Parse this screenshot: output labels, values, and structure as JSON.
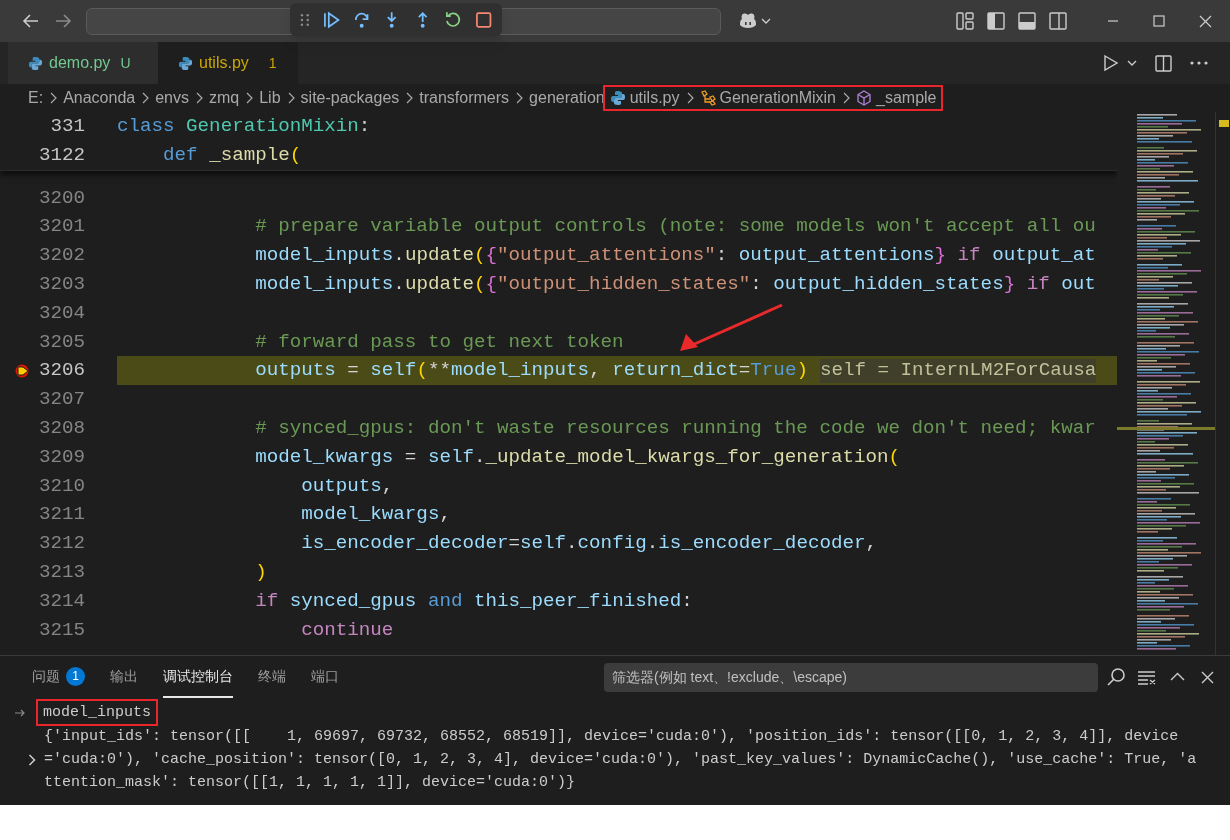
{
  "tabs": [
    {
      "label": "demo.py",
      "badge": "U",
      "kind": "untracked",
      "selected": false
    },
    {
      "label": "utils.py",
      "badge": "1",
      "kind": "problems",
      "selected": true
    }
  ],
  "breadcrumb": [
    {
      "label": "E:",
      "kind": "folder",
      "annotated": false
    },
    {
      "label": "Anaconda",
      "kind": "folder",
      "annotated": false
    },
    {
      "label": "envs",
      "kind": "folder",
      "annotated": false
    },
    {
      "label": "zmq",
      "kind": "folder",
      "annotated": false
    },
    {
      "label": "Lib",
      "kind": "folder",
      "annotated": false
    },
    {
      "label": "site-packages",
      "kind": "folder",
      "annotated": false
    },
    {
      "label": "transformers",
      "kind": "folder",
      "annotated": false
    },
    {
      "label": "generation",
      "kind": "folder",
      "annotated": false
    },
    {
      "label": "utils.py",
      "kind": "python_file",
      "annotated": true
    },
    {
      "label": "GenerationMixin",
      "kind": "class",
      "annotated": true
    },
    {
      "label": "_sample",
      "kind": "method",
      "annotated": true
    }
  ],
  "sticky_lines": [
    {
      "number": "331",
      "tokens": [
        {
          "text": "class ",
          "kind": "kw"
        },
        {
          "text": "GenerationMixin",
          "kind": "cls"
        },
        {
          "text": ":",
          "kind": "op"
        }
      ]
    },
    {
      "number": "3122",
      "tokens": [
        {
          "text": "    def ",
          "kind": "kw"
        },
        {
          "text": "_sample",
          "kind": "fn"
        },
        {
          "text": "(",
          "kind": "br1"
        }
      ]
    }
  ],
  "code_lines": [
    {
      "number": "3200",
      "current": false
    },
    {
      "number": "3201",
      "current": false,
      "tokens": [
        {
          "text": "            # prepare variable output controls (note: some models won't accept all ou",
          "kind": "com"
        }
      ]
    },
    {
      "number": "3202",
      "current": false,
      "tokens": [
        {
          "text": "            model_inputs",
          "kind": "var"
        },
        {
          "text": ".",
          "kind": "op"
        },
        {
          "text": "update",
          "kind": "fn"
        },
        {
          "text": "(",
          "kind": "br1"
        },
        {
          "text": "{",
          "kind": "br2"
        },
        {
          "text": "\"output_attentions\"",
          "kind": "str"
        },
        {
          "text": ": ",
          "kind": "op"
        },
        {
          "text": "output_attentions",
          "kind": "var"
        },
        {
          "text": "}",
          "kind": "br2"
        },
        {
          "text": " if ",
          "kind": "ctl"
        },
        {
          "text": "output_at",
          "kind": "var"
        }
      ]
    },
    {
      "number": "3203",
      "current": false,
      "tokens": [
        {
          "text": "            model_inputs",
          "kind": "var"
        },
        {
          "text": ".",
          "kind": "op"
        },
        {
          "text": "update",
          "kind": "fn"
        },
        {
          "text": "(",
          "kind": "br1"
        },
        {
          "text": "{",
          "kind": "br2"
        },
        {
          "text": "\"output_hidden_states\"",
          "kind": "str"
        },
        {
          "text": ": ",
          "kind": "op"
        },
        {
          "text": "output_hidden_states",
          "kind": "var"
        },
        {
          "text": "}",
          "kind": "br2"
        },
        {
          "text": " if ",
          "kind": "ctl"
        },
        {
          "text": "out",
          "kind": "var"
        }
      ]
    },
    {
      "number": "3204",
      "current": false
    },
    {
      "number": "3205",
      "current": false,
      "tokens": [
        {
          "text": "            # forward pass to get next token",
          "kind": "com"
        }
      ]
    },
    {
      "number": "3206",
      "current": true,
      "inline_value": "self = InternLM2ForCausa",
      "tokens": [
        {
          "text": "            outputs",
          "kind": "var"
        },
        {
          "text": " = ",
          "kind": "op"
        },
        {
          "text": "self",
          "kind": "var"
        },
        {
          "text": "(",
          "kind": "br1"
        },
        {
          "text": "**",
          "kind": "op"
        },
        {
          "text": "model_inputs",
          "kind": "var"
        },
        {
          "text": ", ",
          "kind": "op"
        },
        {
          "text": "return_dict",
          "kind": "var"
        },
        {
          "text": "=",
          "kind": "op"
        },
        {
          "text": "True",
          "kind": "kw"
        },
        {
          "text": ")",
          "kind": "br1"
        }
      ]
    },
    {
      "number": "3207",
      "current": false
    },
    {
      "number": "3208",
      "current": false,
      "tokens": [
        {
          "text": "            # synced_gpus: don't waste resources running the code we don't need; kwar",
          "kind": "com"
        }
      ]
    },
    {
      "number": "3209",
      "current": false,
      "tokens": [
        {
          "text": "            model_kwargs",
          "kind": "var"
        },
        {
          "text": " = ",
          "kind": "op"
        },
        {
          "text": "self",
          "kind": "var"
        },
        {
          "text": ".",
          "kind": "op"
        },
        {
          "text": "_update_model_kwargs_for_generation",
          "kind": "fn"
        },
        {
          "text": "(",
          "kind": "br1"
        }
      ]
    },
    {
      "number": "3210",
      "current": false,
      "tokens": [
        {
          "text": "                outputs",
          "kind": "var"
        },
        {
          "text": ",",
          "kind": "op"
        }
      ]
    },
    {
      "number": "3211",
      "current": false,
      "tokens": [
        {
          "text": "                model_kwargs",
          "kind": "var"
        },
        {
          "text": ",",
          "kind": "op"
        }
      ]
    },
    {
      "number": "3212",
      "current": false,
      "tokens": [
        {
          "text": "                is_encoder_decoder",
          "kind": "var"
        },
        {
          "text": "=",
          "kind": "op"
        },
        {
          "text": "self",
          "kind": "var"
        },
        {
          "text": ".",
          "kind": "op"
        },
        {
          "text": "config",
          "kind": "var"
        },
        {
          "text": ".",
          "kind": "op"
        },
        {
          "text": "is_encoder_decoder",
          "kind": "var"
        },
        {
          "text": ",",
          "kind": "op"
        }
      ]
    },
    {
      "number": "3213",
      "current": false,
      "tokens": [
        {
          "text": "            )",
          "kind": "br1"
        }
      ]
    },
    {
      "number": "3214",
      "current": false,
      "tokens": [
        {
          "text": "            if ",
          "kind": "ctl"
        },
        {
          "text": "synced_gpus",
          "kind": "var"
        },
        {
          "text": " and ",
          "kind": "kw"
        },
        {
          "text": "this_peer_finished",
          "kind": "var"
        },
        {
          "text": ":",
          "kind": "op"
        }
      ]
    },
    {
      "number": "3215",
      "current": false,
      "tokens": [
        {
          "text": "                continue",
          "kind": "ctl"
        }
      ]
    }
  ],
  "panel": {
    "tabs": [
      {
        "label": "问题",
        "badge": "1",
        "selected": false
      },
      {
        "label": "输出",
        "selected": false
      },
      {
        "label": "调试控制台",
        "selected": true
      },
      {
        "label": "终端",
        "selected": false
      },
      {
        "label": "端口",
        "selected": false
      }
    ],
    "filter": {
      "placeholder": "筛选器(例如 text、!exclude、\\escape)"
    },
    "console": {
      "input": "model_inputs",
      "input_annotated": true,
      "output": [
        {
          "text": "{'input_ids': tensor([[    1, 69697, 69732, 68552, 68519]], device='cuda:0'), 'position_ids': tensor([[0, 1, 2, 3, 4]], device",
          "expandable": false
        },
        {
          "text": "='cuda:0'), 'cache_position': tensor([0, 1, 2, 3, 4], device='cuda:0'), 'past_key_values': DynamicCache(), 'use_cache': True, 'a",
          "expandable": true
        },
        {
          "text": "ttention_mask': tensor([[1, 1, 1, 1, 1]], device='cuda:0')}",
          "expandable": false
        }
      ]
    }
  }
}
